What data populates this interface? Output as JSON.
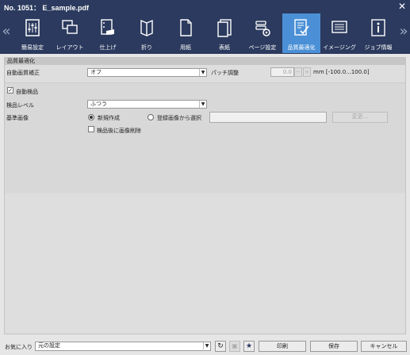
{
  "window": {
    "title": "No. 1051： E_sample.pdf"
  },
  "tabs": [
    {
      "label": "簡易設定",
      "icon": "simple-settings-icon"
    },
    {
      "label": "レイアウト",
      "icon": "layout-icon"
    },
    {
      "label": "仕上げ",
      "icon": "finishing-icon"
    },
    {
      "label": "折り",
      "icon": "fold-icon"
    },
    {
      "label": "用紙",
      "icon": "paper-icon"
    },
    {
      "label": "表紙",
      "icon": "cover-icon"
    },
    {
      "label": "ページ設定",
      "icon": "page-settings-icon"
    },
    {
      "label": "品質最適化",
      "icon": "quality-optimization-icon",
      "active": true
    },
    {
      "label": "イメージング",
      "icon": "imaging-icon"
    },
    {
      "label": "ジョブ情報",
      "icon": "job-info-icon"
    }
  ],
  "section": {
    "title": "品質最適化",
    "auto_correction": {
      "label": "自動画質補正",
      "value": "オフ"
    },
    "patch_adjust": {
      "label": "パッチ調整",
      "value": "0.0",
      "minus": "−",
      "plus": "+",
      "unit": "mm [-100.0...100.0]"
    },
    "auto_inspection": {
      "label": "自動検品",
      "checked": true
    },
    "inspection_level": {
      "label": "検品レベル",
      "value": "ふつう"
    },
    "reference_image": {
      "label": "基準画像",
      "option_new": "新規作成",
      "option_registered": "登録画像から選択",
      "change_button": "変更..."
    },
    "delete_after": {
      "label": "検品後に画像削除",
      "checked": false
    }
  },
  "footer": {
    "favorites_label": "お気に入り",
    "favorites_value": "元の設定",
    "print_button": "印刷",
    "save_button": "保存",
    "cancel_button": "キャンセル"
  },
  "colors": {
    "titlebar": "#2b3a5e",
    "accent": "#4b90d6"
  }
}
